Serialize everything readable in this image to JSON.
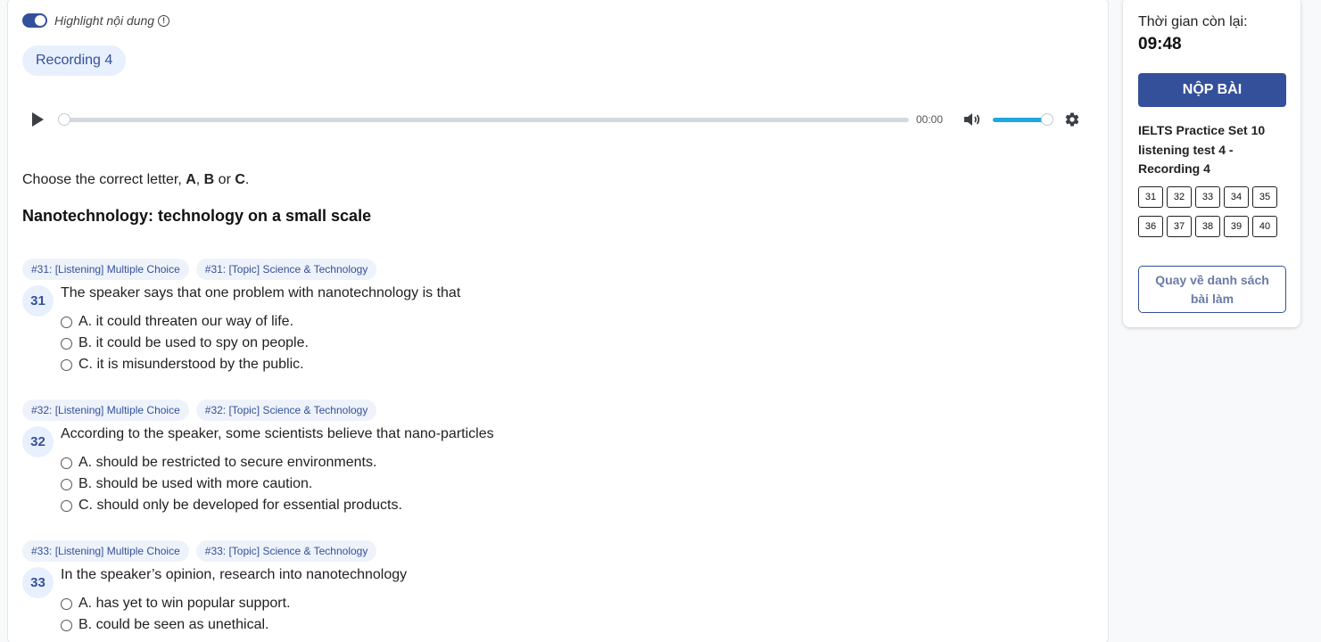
{
  "highlight": {
    "label": "Highlight nội dung",
    "enabled": true,
    "info_glyph": "!"
  },
  "recording_pill": "Recording 4",
  "player": {
    "time": "00:00",
    "progress": 0,
    "volume": 1.0
  },
  "instruction": {
    "prefix": "Choose the correct letter, ",
    "a": "A",
    "sep1": ", ",
    "b": "B",
    "sep2": " or ",
    "c": "C",
    "suffix": "."
  },
  "section_title": "Nanotechnology: technology on a small scale",
  "questions": [
    {
      "tags": [
        "#31: [Listening] Multiple Choice",
        "#31: [Topic] Science & Technology"
      ],
      "number": "31",
      "text": "The speaker says that one problem with nanotechnology is that",
      "options": [
        "A. it could threaten our way of life.",
        "B. it could be used to spy on people.",
        "C. it is misunderstood by the public."
      ]
    },
    {
      "tags": [
        "#32: [Listening] Multiple Choice",
        "#32: [Topic] Science & Technology"
      ],
      "number": "32",
      "text": "According to the speaker, some scientists believe that nano-particles",
      "options": [
        "A. should be restricted to secure environments.",
        "B. should be used with more caution.",
        "C. should only be developed for essential products."
      ]
    },
    {
      "tags": [
        "#33: [Listening] Multiple Choice",
        "#33: [Topic] Science & Technology"
      ],
      "number": "33",
      "text": "In the speaker’s opinion, research into nanotechnology",
      "options": [
        "A. has yet to win popular support.",
        "B. could be seen as unethical."
      ]
    }
  ],
  "sidebar": {
    "time_label": "Thời gian còn lại:",
    "time_value": "09:48",
    "submit_label": "NỘP BÀI",
    "test_title": "IELTS Practice Set 10 listening test 4 - Recording 4",
    "question_numbers": [
      "31",
      "32",
      "33",
      "34",
      "35",
      "36",
      "37",
      "38",
      "39",
      "40"
    ],
    "back_label": "Quay về danh sách bài làm"
  },
  "colors": {
    "primary": "#35509a",
    "pill_bg": "#e8f0fe",
    "volume": "#1fa7e0"
  }
}
